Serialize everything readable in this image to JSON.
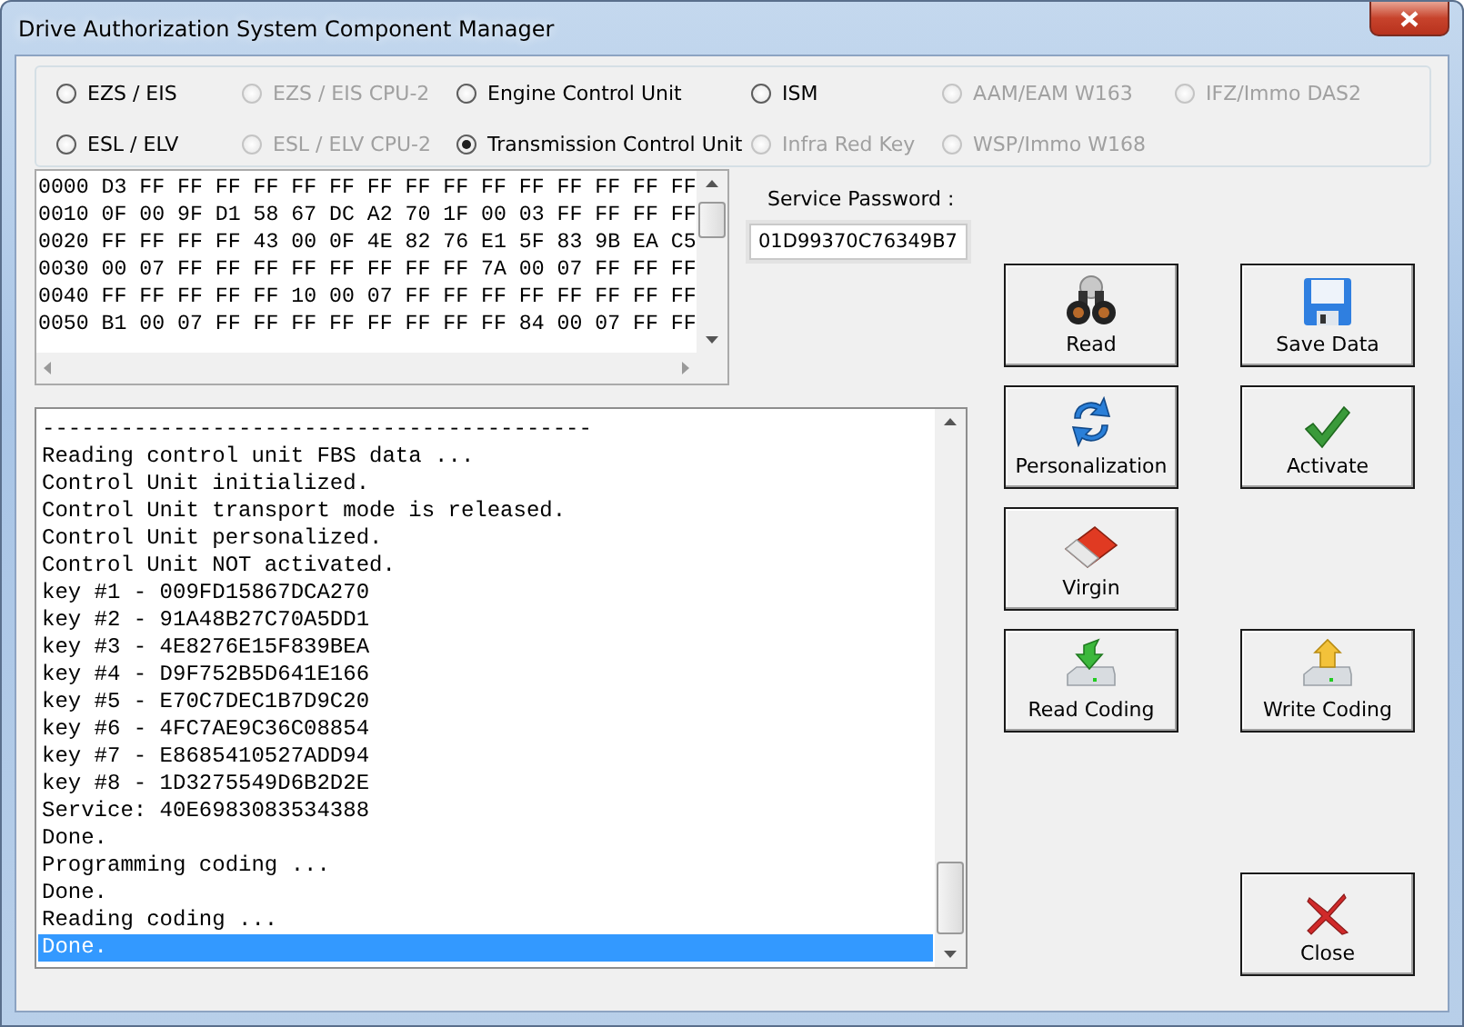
{
  "window": {
    "title": "Drive Authorization System Component Manager"
  },
  "modules": [
    {
      "label": "EZS / EIS",
      "selected": false,
      "disabled": false
    },
    {
      "label": "EZS / EIS CPU-2",
      "selected": false,
      "disabled": true
    },
    {
      "label": "Engine Control Unit",
      "selected": false,
      "disabled": false
    },
    {
      "label": "ISM",
      "selected": false,
      "disabled": false
    },
    {
      "label": "AAM/EAM W163",
      "selected": false,
      "disabled": true
    },
    {
      "label": "IFZ/Immo DAS2",
      "selected": false,
      "disabled": true
    },
    {
      "label": "ESL / ELV",
      "selected": false,
      "disabled": false
    },
    {
      "label": "ESL / ELV CPU-2",
      "selected": false,
      "disabled": true
    },
    {
      "label": "Transmission Control Unit",
      "selected": true,
      "disabled": false
    },
    {
      "label": "Infra Red Key",
      "selected": false,
      "disabled": true
    },
    {
      "label": "WSP/Immo W168",
      "selected": false,
      "disabled": true
    }
  ],
  "hex_view": {
    "rows": [
      "0000 D3 FF FF FF FF FF FF FF FF FF FF FF FF FF FF FF",
      "0010 0F 00 9F D1 58 67 DC A2 70 1F 00 03 FF FF FF FF",
      "0020 FF FF FF FF 43 00 0F 4E 82 76 E1 5F 83 9B EA C5",
      "0030 00 07 FF FF FF FF FF FF FF FF 7A 00 07 FF FF FF",
      "0040 FF FF FF FF FF 10 00 07 FF FF FF FF FF FF FF FF",
      "0050 B1 00 07 FF FF FF FF FF FF FF FF 84 00 07 FF FF"
    ]
  },
  "service_password": {
    "label": "Service Password :",
    "value": "01D99370C76349B7"
  },
  "log": [
    {
      "text": "------------------------------------------",
      "selected": false
    },
    {
      "text": "Reading control unit FBS data ...",
      "selected": false
    },
    {
      "text": "Control Unit initialized.",
      "selected": false
    },
    {
      "text": "Control Unit transport mode is released.",
      "selected": false
    },
    {
      "text": "Control Unit personalized.",
      "selected": false
    },
    {
      "text": "Control Unit NOT activated.",
      "selected": false
    },
    {
      "text": "key #1 - 009FD15867DCA270",
      "selected": false
    },
    {
      "text": "key #2 - 91A48B27C70A5DD1",
      "selected": false
    },
    {
      "text": "key #3 - 4E8276E15F839BEA",
      "selected": false
    },
    {
      "text": "key #4 - D9F752B5D641E166",
      "selected": false
    },
    {
      "text": "key #5 - E70C7DEC1B7D9C20",
      "selected": false
    },
    {
      "text": "key #6 - 4FC7AE9C36C08854",
      "selected": false
    },
    {
      "text": "key #7 - E8685410527ADD94",
      "selected": false
    },
    {
      "text": "key #8 - 1D3275549D6B2D2E",
      "selected": false
    },
    {
      "text": "Service: 40E6983083534388",
      "selected": false
    },
    {
      "text": "Done.",
      "selected": false
    },
    {
      "text": "Programming coding ...",
      "selected": false
    },
    {
      "text": "Done.",
      "selected": false
    },
    {
      "text": "Reading coding ...",
      "selected": false
    },
    {
      "text": "Done.",
      "selected": true
    }
  ],
  "buttons": [
    {
      "label": "Read"
    },
    {
      "label": "Save Data"
    },
    {
      "label": "Personalization"
    },
    {
      "label": "Activate"
    },
    {
      "label": "Virgin"
    },
    {
      "label": "Read Coding"
    },
    {
      "label": "Write Coding"
    },
    {
      "label": "Close"
    }
  ]
}
